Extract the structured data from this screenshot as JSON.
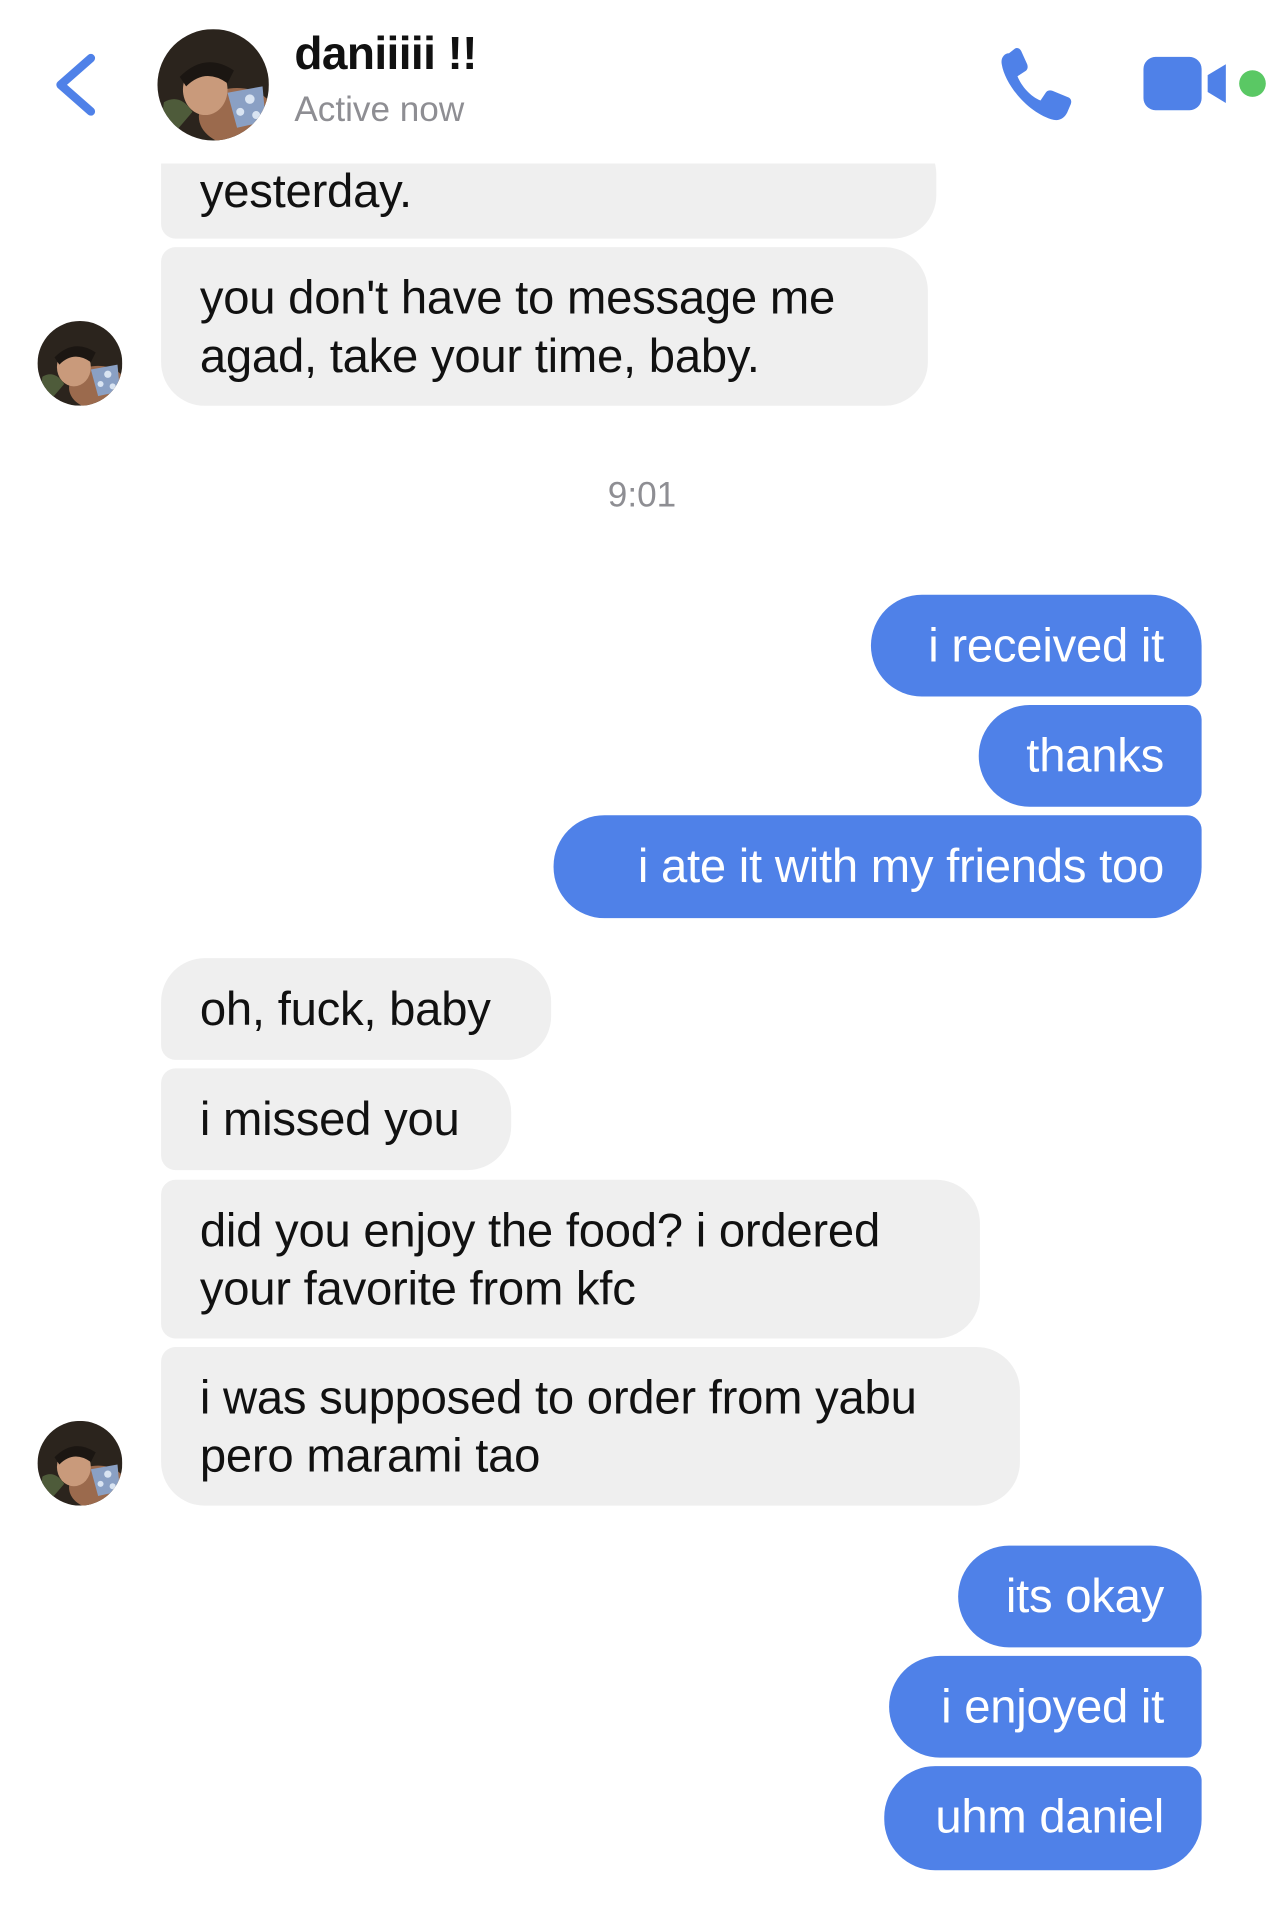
{
  "header": {
    "contact_name": "daniiiii !!",
    "status": "Active now",
    "accent_color": "#4f81e8",
    "online_color": "#5ac864",
    "icons": [
      "chevron-left-icon",
      "phone-icon",
      "video-camera-icon"
    ]
  },
  "messages": [
    {
      "side": "incoming",
      "text": "yesterday."
    },
    {
      "side": "incoming",
      "text": "you don't have to message me\nagad, take your time, baby."
    },
    {
      "side": "timestamp",
      "text": "9:01"
    },
    {
      "side": "outgoing",
      "text": "i received it"
    },
    {
      "side": "outgoing",
      "text": "thanks"
    },
    {
      "side": "outgoing",
      "text": "i ate it with my friends too"
    },
    {
      "side": "incoming",
      "text": "oh, fuck, baby"
    },
    {
      "side": "incoming",
      "text": "i missed you"
    },
    {
      "side": "incoming",
      "text": "did you enjoy the food? i ordered\nyour favorite from kfc"
    },
    {
      "side": "incoming",
      "text": "i was supposed to order from yabu\npero marami tao"
    },
    {
      "side": "outgoing",
      "text": "its okay"
    },
    {
      "side": "outgoing",
      "text": "i enjoyed it"
    },
    {
      "side": "outgoing",
      "text": "uhm daniel"
    }
  ]
}
